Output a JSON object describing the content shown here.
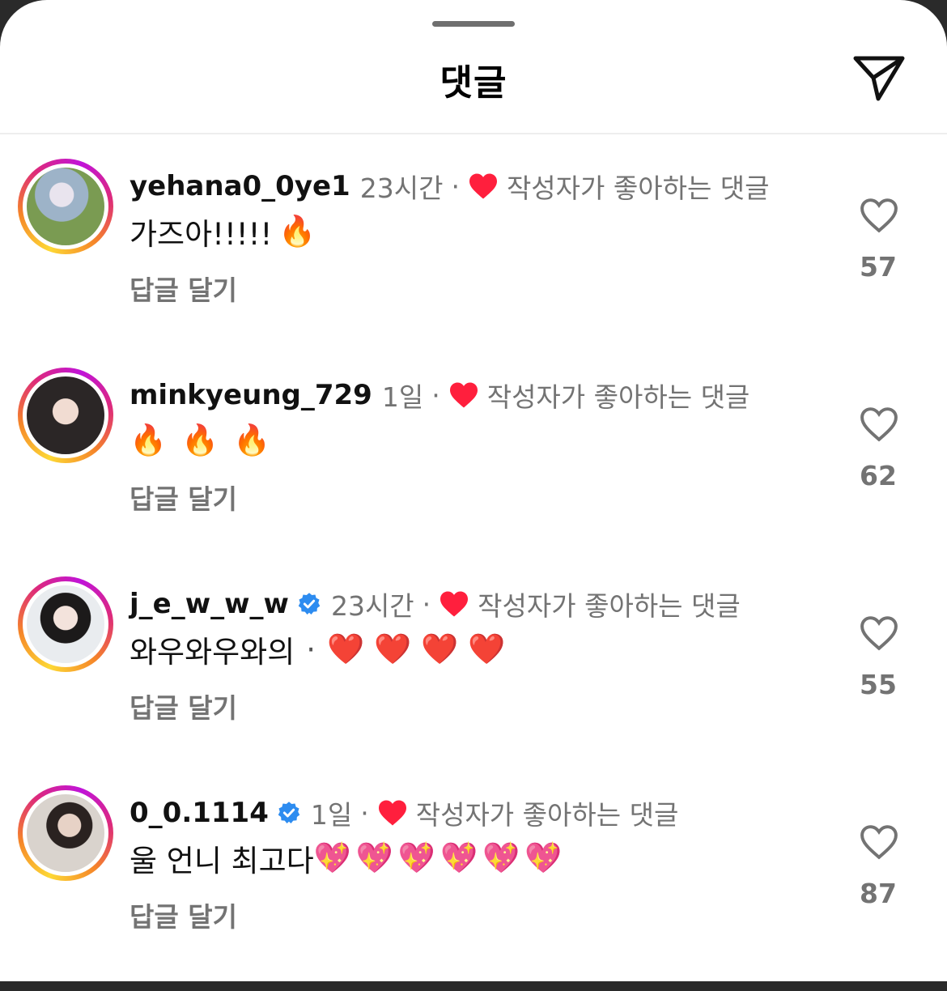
{
  "header": {
    "title": "댓글",
    "share_icon": "paper-plane-icon"
  },
  "colors": {
    "liked_heart": "#ff1f3d",
    "meta_gray": "#737373",
    "verified_blue": "#2d8cf0"
  },
  "comments": [
    {
      "username": "yehana0_0ye1",
      "verified": false,
      "time": "23시간",
      "liked_by_creator": "작성자가 좋아하는 댓글",
      "text": "가즈아!!!!!",
      "emojis": [
        "🔥"
      ],
      "reply_label": "답글 달기",
      "like_count": "57"
    },
    {
      "username": "minkyeung_729",
      "verified": false,
      "time": "1일",
      "liked_by_creator": "작성자가 좋아하는 댓글",
      "text": "",
      "emojis": [
        "🔥",
        "🔥",
        "🔥"
      ],
      "reply_label": "답글 달기",
      "like_count": "62"
    },
    {
      "username": "j_e_w_w_w",
      "verified": true,
      "time": "23시간",
      "liked_by_creator": "작성자가 좋아하는 댓글",
      "text": "와우와우와의",
      "separator": "·",
      "emojis": [
        "❤️",
        "❤️",
        "❤️",
        "❤️"
      ],
      "reply_label": "답글 달기",
      "like_count": "55"
    },
    {
      "username": "0_0.1114",
      "verified": true,
      "time": "1일",
      "liked_by_creator": "작성자가 좋아하는 댓글",
      "text": "울 언니 최고다",
      "emojis": [
        "💖",
        "💖",
        "💖",
        "💖",
        "💖",
        "💖"
      ],
      "reply_label": "답글 달기",
      "like_count": "87"
    }
  ]
}
